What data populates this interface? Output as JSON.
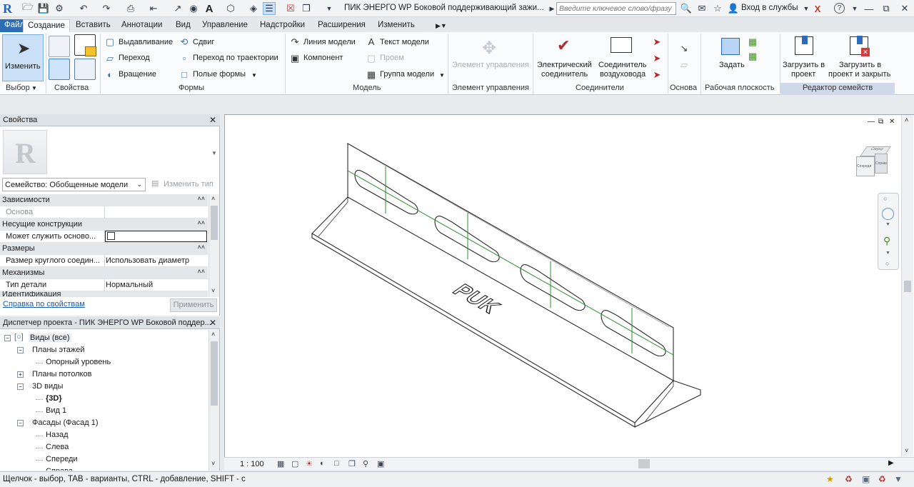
{
  "window": {
    "title": "ПИК ЭНЕРГО WP Боковой поддерживающий зажи...",
    "search_placeholder": "Введите ключевое слово/фразу",
    "signin": "Вход в службы",
    "help": "?"
  },
  "tabs": [
    "Файл",
    "Создание",
    "Вставить",
    "Аннотации",
    "Вид",
    "Управление",
    "Надстройки",
    "Расширения",
    "Изменить"
  ],
  "active_tab": "Создание",
  "ribbon": {
    "select_modify": "Изменить",
    "select_label": "Выбор",
    "properties_label": "Свойства",
    "forms": {
      "extrusion": "Выдавливание",
      "blend": "Переход",
      "revolve": "Вращение",
      "sweep": "Сдвиг",
      "swept_blend": "Переход по траектории",
      "void_forms": "Полые формы",
      "label": "Формы"
    },
    "model": {
      "model_line": "Линия модели",
      "component": "Компонент",
      "model_text": "Текст модели",
      "opening": "Проем",
      "model_group": "Группа модели",
      "label": "Модель"
    },
    "control": {
      "control_element": "Элемент управления",
      "label": "Элемент управления"
    },
    "connectors": {
      "electrical_line1": "Электрический",
      "electrical_line2": "соединитель",
      "duct_line1": "Соединитель",
      "duct_line2": "воздуховода",
      "label": "Соединители"
    },
    "datum_label": "Основа",
    "workplane": {
      "set": "Задать",
      "label": "Рабочая плоскость"
    },
    "family_editor": {
      "load_line1": "Загрузить в",
      "load_line2": "проект",
      "load_close_line1": "Загрузить в",
      "load_close_line2": "проект и закрыть",
      "label": "Редактор семейств"
    }
  },
  "properties": {
    "title": "Свойства",
    "family_selector": "Семейство: Обобщенные модели",
    "edit_type": "Изменить тип",
    "rows": [
      {
        "cat": true,
        "k": "Зависимости",
        "v": ""
      },
      {
        "cat": false,
        "k": "Основа",
        "v": "",
        "dim": true
      },
      {
        "cat": true,
        "k": "Несущие конструкции",
        "v": ""
      },
      {
        "cat": false,
        "k": "Может служить осново...",
        "v": ""
      },
      {
        "cat": true,
        "k": "Размеры",
        "v": ""
      },
      {
        "cat": false,
        "k": "Размер круглого соедин...",
        "v": "Использовать диаметр"
      },
      {
        "cat": true,
        "k": "Механизмы",
        "v": ""
      },
      {
        "cat": false,
        "k": "Тип детали",
        "v": "Нормальный"
      },
      {
        "cat": true,
        "k": "Идентификация",
        "v": ""
      }
    ],
    "help_link": "Справка по свойствам",
    "apply": "Применить"
  },
  "project_browser": {
    "title": "Диспетчер проекта - ПИК ЭНЕРГО WP Боковой поддер...",
    "items": [
      {
        "label": "Виды (все)",
        "level": 0,
        "box": "-"
      },
      {
        "label": "Планы этажей",
        "level": 1,
        "box": "-"
      },
      {
        "label": "Опорный уровень",
        "level": 2,
        "box": ""
      },
      {
        "label": "Планы потолков",
        "level": 1,
        "box": "+"
      },
      {
        "label": "3D виды",
        "level": 1,
        "box": "-"
      },
      {
        "label": "{3D}",
        "level": 2,
        "box": "",
        "bold": true
      },
      {
        "label": "Вид 1",
        "level": 2,
        "box": ""
      },
      {
        "label": "Фасады (Фасад 1)",
        "level": 1,
        "box": "-"
      },
      {
        "label": "Назад",
        "level": 2,
        "box": ""
      },
      {
        "label": "Слева",
        "level": 2,
        "box": ""
      },
      {
        "label": "Спереди",
        "level": 2,
        "box": ""
      },
      {
        "label": "Справа",
        "level": 2,
        "box": ""
      }
    ]
  },
  "view": {
    "scale": "1 : 100",
    "model_text": "PUK",
    "viewcube_faces": [
      "Спереди",
      "Справа",
      "Сверху"
    ]
  },
  "status": {
    "text": "Щелчок - выбор, TAB - варианты, CTRL - добавление, SHIFT - с"
  }
}
